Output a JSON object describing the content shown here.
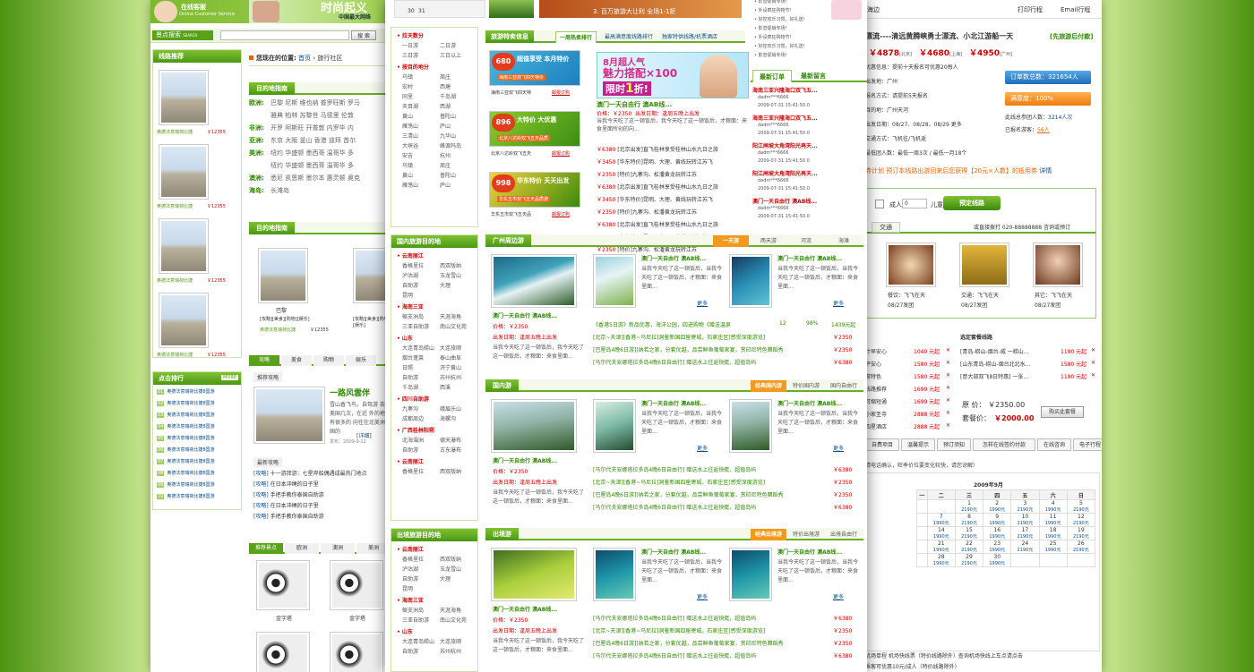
{
  "left": {
    "header": {
      "online_service": "在线客服",
      "online_service_en": "Online Customer Service",
      "brand": "时尚起义",
      "slogan": "中国最大网络"
    },
    "search": {
      "label": "景点搜索",
      "label_en": "SEARCH",
      "button": "搜 索"
    },
    "location": {
      "prefix": "您现在的位置:",
      "home": "首页",
      "sep": "›",
      "current": "旅行社区"
    },
    "route_rec": {
      "title": "线路推荐",
      "caption": "奥德法意瑞荷比捷",
      "price": "￥12355"
    },
    "dest_guide": {
      "title": "目的地指南",
      "rows": [
        {
          "region": "欧洲:",
          "items": "巴黎 尼斯 维也纳 普罗旺斯 罗马"
        },
        {
          "region": "",
          "items": "雅典 柏林 苏黎世 马德里 伦敦"
        },
        {
          "region": "非洲:",
          "items": "开罗 阿斯旺 开普敦 内罗毕 内"
        },
        {
          "region": "亚洲:",
          "items": "东京 大阪 釜山 香港 迪拜 首尔"
        },
        {
          "region": "美洲:",
          "items": "纽约 华盛顿 墨西哥 温哥华 多"
        },
        {
          "region": "",
          "items": "纽约 华盛顿 墨西哥 温哥华 多"
        },
        {
          "region": "澳洲:",
          "items": "悉尼 凯恩斯 墨尔本 惠灵顿 奥克"
        },
        {
          "region": "海岛:",
          "items": "长滩岛"
        }
      ]
    },
    "dest_guide2": {
      "title": "目的地指南",
      "name1": "巴黎",
      "tags": "[攻略][美食][购物][娱乐]",
      "caption": "奥德法意瑞荷比捷",
      "price": "￥12355"
    },
    "tabs": [
      "攻略",
      "美食",
      "购物",
      "娱乐"
    ],
    "feature": {
      "sub": "推荐攻略",
      "title": "一路风雲伴",
      "desc": "雪山香飞鸟，自驾游 去找美国几次，在近 外的地方有很多的 向往在北美洲美国的",
      "more": "[详细]",
      "date": "发布：2009-9-12"
    },
    "latest": {
      "title": "最新攻略",
      "items": [
        {
          "tag": "[攻略]",
          "text": "十一游拜游：七星岸船偶遇成最热门地点"
        },
        {
          "tag": "[攻略]",
          "text": "在日本冲绳的日子里"
        },
        {
          "tag": "[攻略]",
          "text": "手把手教你泰国自助游"
        },
        {
          "tag": "[攻略]",
          "text": "在日本冲绳的日子里"
        },
        {
          "tag": "[攻略]",
          "text": "手把手教你泰国自助游"
        }
      ]
    },
    "ranking": {
      "title": "点击排行",
      "more": "MORE",
      "item": "奥德法意瑞荷比捷8国游",
      "nums": [
        "01",
        "02",
        "03",
        "04",
        "05",
        "06",
        "07",
        "08",
        "09",
        "10"
      ]
    },
    "spots": {
      "tabs": [
        "推荐景点",
        "欧洲",
        "澳洲",
        "美洲"
      ],
      "caption": "金字塔"
    }
  },
  "center": {
    "calendar_days": [
      "30",
      "31"
    ],
    "banner_text": "3. 百万旅游大让利 全场1-1折",
    "tabs": [
      "一周热卖排行",
      "最高满意度线路排行",
      "独家特供线路/机票酒店"
    ],
    "hot_title": "旅游特卖信息",
    "promos": [
      {
        "price": "680",
        "unit": "元",
        "line1": "超值享受 本月特价",
        "line2": "海南三亚双飞四天特价",
        "cap": "海南三亚双飞四天特",
        "link": "邮报订购"
      },
      {
        "price": "896",
        "unit": "元",
        "line1": "大特价 大优惠",
        "line2": "北京八达岭双飞五天品质",
        "cap": "北京八达岭双飞五天",
        "link": "邮报订购"
      },
      {
        "price": "998",
        "unit": "元",
        "line1": "华东特价 天天出发",
        "line2": "华东五市双飞五天品质游",
        "cap": "华东五市双飞五天品",
        "link": "邮报订购"
      }
    ],
    "hero": {
      "line1": "8月超人气",
      "line2": "魅力搭配×100",
      "line3": "限时",
      "line4": "1",
      "line5": "折!"
    },
    "hot_first": {
      "title": "澳门一天自由行 澳AB线...",
      "price": "价格：￥2350",
      "date": "出发日期：逢周五晚上出发",
      "desc": "当我今天吃了这一顿饭后，我今天吃了这一顿饭后，才粮面：来食里面所创的向...",
      "more": "更多"
    },
    "hot_list": [
      {
        "price": "￥6380",
        "text": "[北京出发]直飞桂林享受桂林山水九日之旅"
      },
      {
        "price": "￥3450",
        "text": "[华东特价]昆明、大理、黄线玩转江苏飞"
      },
      {
        "price": "￥2350",
        "text": "[特价]九寨沟、松潘黄龙玩转江苏"
      },
      {
        "price": "￥6380",
        "text": "[北京出发]直飞桂林享受桂林山水九日之旅"
      },
      {
        "price": "￥3450",
        "text": "[华东特价]昆明、大理、黄线玩转江苏飞"
      },
      {
        "price": "￥2350",
        "text": "[特价]九寨沟、松潘黄龙玩转江苏"
      },
      {
        "price": "￥6380",
        "text": "[北京出发]直飞桂林享受桂林山水九日之旅"
      },
      {
        "price": "￥3450",
        "text": "[华东特价]昆明、大理、黄线玩转江苏飞"
      },
      {
        "price": "￥2350",
        "text": "[特价]九寨沟、松潘黄龙玩转江苏"
      }
    ],
    "orders_tabs": [
      "最新订单",
      "最新留言"
    ],
    "orders": [
      {
        "title": "海南三亚兴隆海口双飞五...",
        "user": "dadm***6666",
        "time": "2009-07-31 15:41:50.0"
      },
      {
        "title": "海南三亚兴隆海口双飞五...",
        "user": "dadm***6666",
        "time": "2009-07-31 15:41:50.0"
      },
      {
        "title": "阳江闸坡大角湾阳光再天...",
        "user": "dadm***6666",
        "time": "2009-07-31 15:41:50.0"
      },
      {
        "title": "阳江闸坡大角湾阳光再天...",
        "user": "dadm***6666",
        "time": "2009-07-31 15:41:50.0"
      },
      {
        "title": "澳门一天自由行 澳AB线...",
        "user": "dadm***6666",
        "time": "2009-07-31 15:41:50.0"
      }
    ],
    "promo_list": [
      "影音促销专场！",
      "外设疯狂购物节！",
      "好控欢乐习惯，好礼送！",
      "影音促销专场！",
      "外设疯狂购物节！",
      "好控欢乐习惯，好礼送！",
      "影音促销专场！"
    ],
    "domestic_title": "国内旅游目的地",
    "outbound_title": "出境旅游目的地",
    "dest_groups": [
      {
        "head": "拉天数分",
        "items": [
          "一日游",
          "二日游",
          "三日游",
          "三日以上"
        ]
      },
      {
        "head": "按目的地分",
        "items": [
          "乌镇",
          "周庄",
          "宏村",
          "西塘",
          "同里",
          "千岛湖",
          "天目湖",
          "西湖",
          "黄山",
          "普陀山",
          "雁荡山",
          "庐山",
          "三清山",
          "九华山",
          "大峡谷",
          "峰源玛岛",
          "安吉",
          "杭州",
          "乌镇",
          "周庄",
          "黄山",
          "普陀山",
          "雁荡山",
          "庐山"
        ]
      }
    ],
    "dest_groups2": [
      {
        "head": "云南丽江",
        "items": [
          "香格里拉",
          "西双版纳",
          "泸沽湖",
          "玉龙雪山",
          "自助游",
          "大理",
          "昆明"
        ]
      },
      {
        "head": "海南三亚",
        "items": [
          "蜈支洲岛",
          "天涯海角",
          "三亚自助游",
          "南山文化苑"
        ]
      },
      {
        "head": "山东",
        "items": [
          "大连青岛崂山",
          "大连旅顺",
          "烟台蓬莱",
          "泰山曲阜",
          "日照",
          "济宁黄山",
          "自助游",
          "苏州杭州",
          "千岛湖",
          "西溪"
        ]
      },
      {
        "head": "四川自助游",
        "items": [
          "九寨沟",
          "峨眉乐山",
          "成都周边",
          "海螺沟"
        ]
      },
      {
        "head": "广西桂林阳朔",
        "items": [
          "北海涠洲",
          "德天瀑布",
          "自助游",
          "古东瀑布"
        ]
      },
      {
        "head": "云南丽江",
        "items": [
          "香格里拉",
          "西双版纳"
        ]
      }
    ],
    "dest_groups3": [
      {
        "head": "云南丽江",
        "items": [
          "香格里拉",
          "西双版纳",
          "泸沽湖",
          "玉龙雪山",
          "自助游",
          "大理",
          "昆明"
        ]
      },
      {
        "head": "海南三亚",
        "items": [
          "蜈支洲岛",
          "天涯海角",
          "三亚自助游",
          "南山文化苑"
        ]
      },
      {
        "head": "山东",
        "items": [
          "大连青岛崂山",
          "大连旅顺",
          "自助游",
          "苏州杭州"
        ]
      }
    ],
    "sections": [
      {
        "title": "广州周边游",
        "tabs": [
          "一天游",
          "两天游",
          "河流",
          "海滩"
        ]
      },
      {
        "title": "国内游",
        "tabs": [
          "经典国内游",
          "特价国内游",
          "国内自由行"
        ]
      },
      {
        "title": "出境游",
        "tabs": [
          "经典出境游",
          "特价出境游",
          "出境自由行"
        ]
      }
    ],
    "card": {
      "title": "澳门一天自由行 澳AB线...",
      "price": "价格：￥2350",
      "date": "出发日期：逢周五晚上出发",
      "desc1": "当我今天吃了这一顿饭后，我今天吃了这一顿饭后，才粮面：来食里面...",
      "more": "更多"
    },
    "card2": {
      "title": "澳门一天自由行 澳AB线...",
      "desc": "当我今天吃了这一顿饭后，当我今天吃了这一顿饭后，才粮面：来食里面...",
      "more": "更多"
    },
    "sec1_list": [
      {
        "text": "《香港5日游》新品优惠，海洋公园，四进购物《赠送温泉",
        "a": "12",
        "b": "98%",
        "c": "1439元起"
      },
      {
        "text": "[北京~天津][香港~马尼拉]洞鉴新国四座寄城，石家庄区[感受深度游览]",
        "price": "￥2350"
      },
      {
        "text": "[巴厘岛4晚6日游][纳若之家，分套优越，品尝鲜鱼葡萄家宴，赏印尼特色舞蹈秀",
        "price": "￥2350"
      },
      {
        "text": "[马尔代夫安娜塔拉多岛4晚6日自由行] 赠送水上往返快艇，超值岛屿",
        "price": "￥6380"
      }
    ],
    "sec2_list": [
      {
        "text": "[马尔代夫安娜塔拉多岛4晚6日自由行] 赠送水上往返快艇，超值岛屿",
        "price": "￥6380"
      },
      {
        "text": "[北京~天津][香港~马尼拉]洞鉴新国四座寄城，石家庄区[感受深度游览]",
        "price": "￥2350"
      },
      {
        "text": "[巴厘岛4晚6日游][纳若之家，分套优越，品尝鲜鱼葡萄家宴，赏印尼特色舞蹈秀",
        "price": "￥2350"
      },
      {
        "text": "[马尔代夫安娜塔拉多岛4晚6日自由行] 赠送水上往返快艇，超值岛屿",
        "price": "￥6380"
      }
    ],
    "sec3_list": [
      {
        "text": "[马尔代夫安娜塔拉多岛4晚6日自由行] 赠送水上往返快艇，超值岛屿",
        "price": "￥6380"
      },
      {
        "text": "[北京~天津][香港~马尼拉]洞鉴新国四座寄城，石家庄区[感受深度游览]",
        "price": "￥2350"
      },
      {
        "text": "[巴厘岛4晚6日游][纳若之家，分套优越，品尝鲜鱼葡萄家宴，赏印尼特色舞蹈秀",
        "price": "￥2350"
      },
      {
        "text": "[马尔代夫安娜塔拉多岛4晚6日自由行] 赠送水上往返快艇，超值岛屿",
        "price": "￥6380"
      }
    ]
  },
  "right": {
    "top_partial": "海边",
    "print": "打印行程",
    "email": "Email行程",
    "title": "漂流----清远黄腾峡勇士漂流、小北江游船一天",
    "title_tag": "[先旅游后付款]",
    "prices": [
      {
        "v": "￥4878",
        "city": "[北京]"
      },
      {
        "v": "￥4680",
        "city": "[上海]"
      },
      {
        "v": "￥4950",
        "city": "[广州]"
      }
    ],
    "info": [
      "优惠信息：提前十天报名可优惠20每人",
      "出发地：广州",
      "报名方式：请提前5天报名",
      "目的地：广州天河",
      "出发日期：08/27、08/28、08/29 更多",
      "交通方式：飞机往/飞机返",
      "最低团人数：最低一周3次 / 最低一月18个"
    ],
    "orders_count": "订单数总数：321654人",
    "satisfaction": "满意度：100%",
    "group_label": "此线总参团人数：",
    "group_num": "3214人次",
    "signed_label": "已报名游客：",
    "signed_num": "56人",
    "promo": "券计划  预订本线路出游回来后您获得【20元×人数】的抵用券",
    "promo_link": "详情",
    "adult_label": "成人",
    "adult_val": "0",
    "child_label": "儿童",
    "book_btn": "预定线路",
    "transport_tab": "交通",
    "hotline": "或直接拨打 020-88888888 咨询或预订",
    "facilities": [
      {
        "cap": "餐饮：飞飞在天",
        "date": "08/27发团"
      },
      {
        "cap": "交通：飞飞在天",
        "date": "08/27发团"
      },
      {
        "cap": "其它：飞飞在天",
        "date": "08/27发团"
      }
    ],
    "set_title": "选定套餐线路",
    "left_items": [
      {
        "t": "计早安心",
        "p": "1040 元起"
      },
      {
        "t": "平安心",
        "p": "1580 元起"
      },
      {
        "t": "游特色",
        "p": "1580 元起"
      },
      {
        "t": "线路推荐",
        "p": "1699 元起"
      },
      {
        "t": "可缩短通",
        "p": "1699 元起"
      },
      {
        "t": "小家圣寺",
        "p": "2888 元起"
      },
      {
        "t": "四星酒店",
        "p": "2888 元起"
      }
    ],
    "set_items": [
      {
        "t": "[青岛-崂山-烟台-威 一崂山...",
        "p": "1190 元起"
      },
      {
        "t": "[山东青岛-崂山-烟台北北水...",
        "p": "1580 元起"
      },
      {
        "t": "[意大部双飞8日特惠] 一张...",
        "p": "1190 元起"
      }
    ],
    "orig_label": "原  价：",
    "orig_price": "￥2350.00",
    "set_label": "套餐价：",
    "set_price": "￥2000.00",
    "buy_btn": "购买此套餐",
    "detail_tabs": [
      "自费项目",
      "温馨提示",
      "预订须知",
      "怎样在线签约付款",
      "在线咨询",
      "电子行程"
    ],
    "notice": "请电话确认，旺季价位要变化较快，请您谅解）",
    "cal_month": "2009年9月",
    "cal_head": [
      "日",
      "一",
      "二",
      "三",
      "四",
      "五",
      "六",
      "日"
    ],
    "cal_rows": [
      [
        "",
        "",
        "1",
        "2",
        "3",
        "4",
        "5"
      ],
      [
        "",
        "7",
        "8",
        "9",
        "10",
        "11",
        "12"
      ],
      [
        "",
        "14",
        "15",
        "16",
        "17",
        "18",
        "19"
      ],
      [
        "",
        "21",
        "22",
        "23",
        "24",
        "25",
        "26"
      ],
      [
        "",
        "28",
        "29",
        "30",
        "",
        "",
        ""
      ]
    ],
    "cal_price": "1990元",
    "cal_price2": "2190元",
    "bottom1": "机场单程 机场快线票（特价线路除外）查询机场快线上车点请点击",
    "bottom2": "乘客可优惠10元/成人（特价线路除外）"
  }
}
